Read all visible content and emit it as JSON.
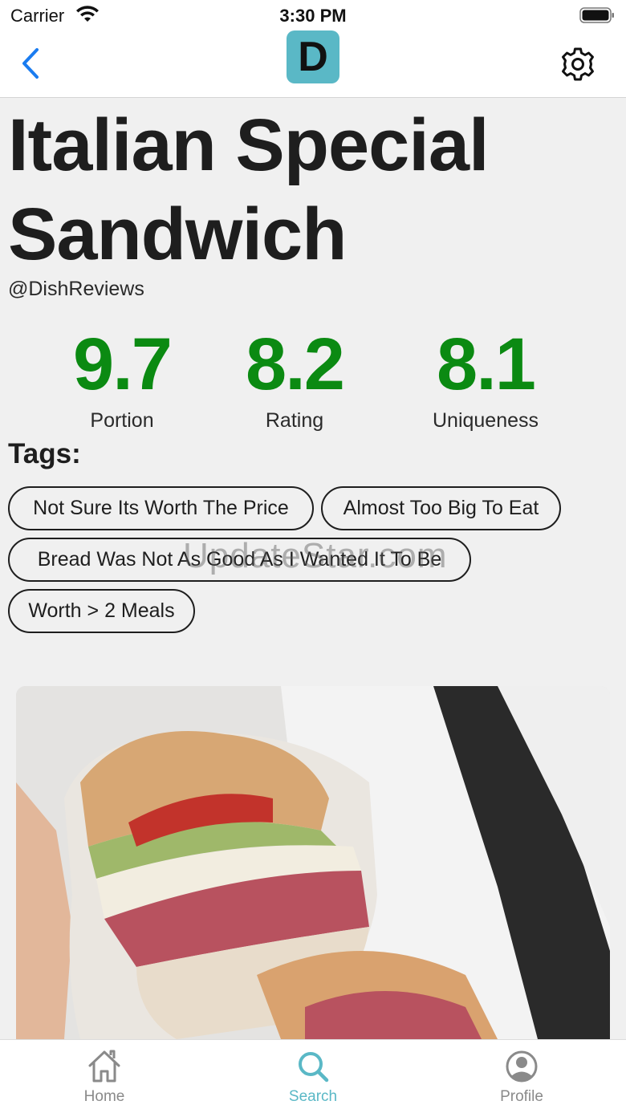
{
  "status_bar": {
    "carrier": "Carrier",
    "time": "3:30 PM"
  },
  "nav": {
    "logo_letter": "D"
  },
  "dish": {
    "title_line1": "Italian Special",
    "title_line2": "Sandwich",
    "handle": "@DishReviews"
  },
  "scores": [
    {
      "value": "9.7",
      "label": "Portion"
    },
    {
      "value": "8.2",
      "label": "Rating"
    },
    {
      "value": "8.1",
      "label": "Uniqueness"
    }
  ],
  "tags_heading": "Tags:",
  "tags": [
    "Not Sure Its Worth The Price",
    "Almost Too Big To Eat",
    "Bread Was Not As Good As I Wanted It To Be",
    "Worth > 2 Meals"
  ],
  "watermark": "UpdateStar.com",
  "tab_bar": {
    "items": [
      {
        "label": "Home",
        "icon": "home-icon",
        "active": false
      },
      {
        "label": "Search",
        "icon": "search-icon",
        "active": true
      },
      {
        "label": "Profile",
        "icon": "profile-icon",
        "active": false
      }
    ],
    "active_color": "#5ab8c6",
    "inactive_color": "#8a8a8a"
  },
  "colors": {
    "score_green": "#0b8a12",
    "accent_blue": "#1a7cf0",
    "logo_bg": "#5ab8c6"
  }
}
